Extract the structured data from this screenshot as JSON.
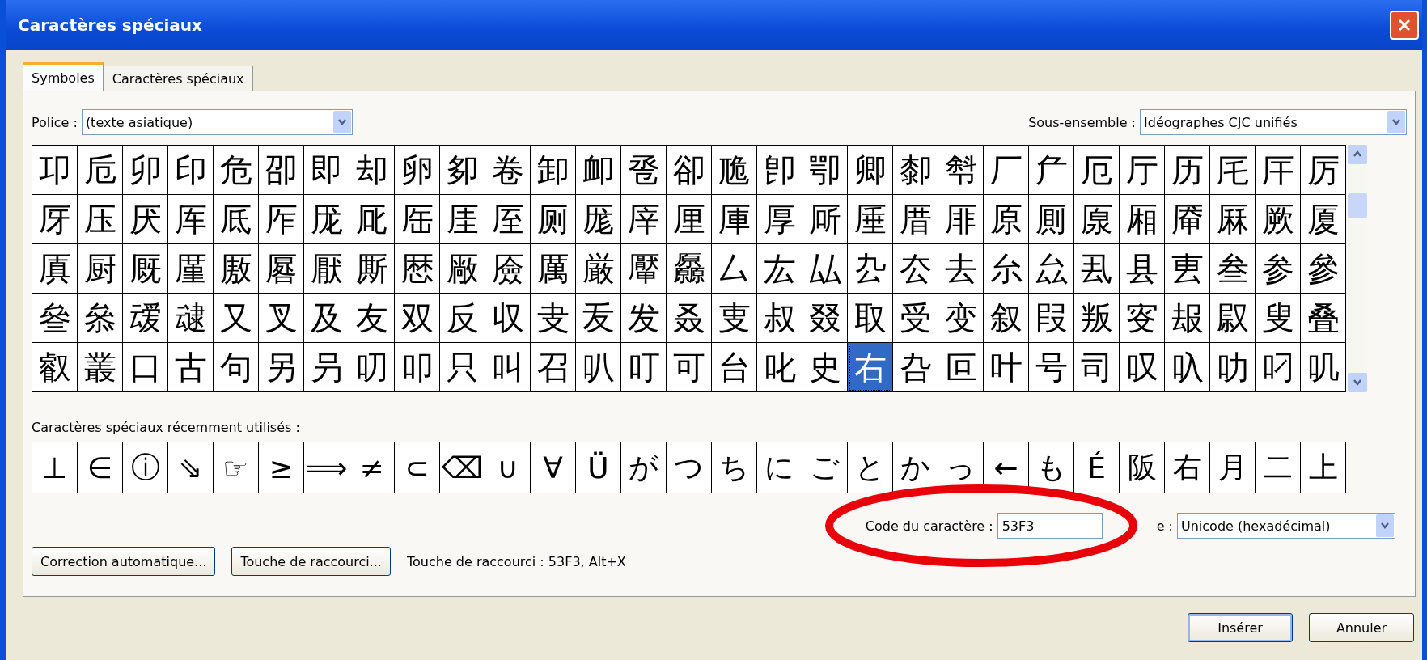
{
  "window": {
    "title": "Caractères spéciaux"
  },
  "tabs": [
    {
      "label": "Symboles",
      "selected": true
    },
    {
      "label": "Caractères spéciaux",
      "selected": false
    }
  ],
  "font_field": {
    "label": "Police :",
    "value": "(texte asiatique)"
  },
  "subset_field": {
    "label": "Sous-ensemble :",
    "value": "Idéographes CJC unifiés"
  },
  "grid": [
    [
      {
        "char": "卭",
        "selected": false
      },
      {
        "char": "卮",
        "selected": false
      },
      {
        "char": "卯",
        "selected": false
      },
      {
        "char": "印",
        "selected": false
      },
      {
        "char": "危",
        "selected": false
      },
      {
        "char": "卲",
        "selected": false
      },
      {
        "char": "即",
        "selected": false
      },
      {
        "char": "却",
        "selected": false
      },
      {
        "char": "卵",
        "selected": false
      },
      {
        "char": "卶",
        "selected": false
      },
      {
        "char": "卷",
        "selected": false
      },
      {
        "char": "卸",
        "selected": false
      },
      {
        "char": "卹",
        "selected": false
      },
      {
        "char": "卺",
        "selected": false
      },
      {
        "char": "卻",
        "selected": false
      },
      {
        "char": "卼",
        "selected": false
      },
      {
        "char": "卽",
        "selected": false
      },
      {
        "char": "卾",
        "selected": false
      },
      {
        "char": "卿",
        "selected": false
      },
      {
        "char": "厀",
        "selected": false
      },
      {
        "char": "厁",
        "selected": false
      },
      {
        "char": "厂",
        "selected": false
      },
      {
        "char": "厃",
        "selected": false
      },
      {
        "char": "厄",
        "selected": false
      },
      {
        "char": "厅",
        "selected": false
      },
      {
        "char": "历",
        "selected": false
      },
      {
        "char": "厇",
        "selected": false
      },
      {
        "char": "厈",
        "selected": false
      },
      {
        "char": "厉",
        "selected": false
      }
    ],
    [
      {
        "char": "厊",
        "selected": false
      },
      {
        "char": "压",
        "selected": false
      },
      {
        "char": "厌",
        "selected": false
      },
      {
        "char": "厍",
        "selected": false
      },
      {
        "char": "厎",
        "selected": false
      },
      {
        "char": "厏",
        "selected": false
      },
      {
        "char": "厐",
        "selected": false
      },
      {
        "char": "厑",
        "selected": false
      },
      {
        "char": "厒",
        "selected": false
      },
      {
        "char": "厓",
        "selected": false
      },
      {
        "char": "厔",
        "selected": false
      },
      {
        "char": "厕",
        "selected": false
      },
      {
        "char": "厖",
        "selected": false
      },
      {
        "char": "厗",
        "selected": false
      },
      {
        "char": "厘",
        "selected": false
      },
      {
        "char": "厙",
        "selected": false
      },
      {
        "char": "厚",
        "selected": false
      },
      {
        "char": "厛",
        "selected": false
      },
      {
        "char": "厜",
        "selected": false
      },
      {
        "char": "厝",
        "selected": false
      },
      {
        "char": "厞",
        "selected": false
      },
      {
        "char": "原",
        "selected": false
      },
      {
        "char": "厠",
        "selected": false
      },
      {
        "char": "厡",
        "selected": false
      },
      {
        "char": "厢",
        "selected": false
      },
      {
        "char": "厣",
        "selected": false
      },
      {
        "char": "厤",
        "selected": false
      },
      {
        "char": "厥",
        "selected": false
      },
      {
        "char": "厦",
        "selected": false
      }
    ],
    [
      {
        "char": "厧",
        "selected": false
      },
      {
        "char": "厨",
        "selected": false
      },
      {
        "char": "厩",
        "selected": false
      },
      {
        "char": "厪",
        "selected": false
      },
      {
        "char": "厫",
        "selected": false
      },
      {
        "char": "厬",
        "selected": false
      },
      {
        "char": "厭",
        "selected": false
      },
      {
        "char": "厮",
        "selected": false
      },
      {
        "char": "厯",
        "selected": false
      },
      {
        "char": "厰",
        "selected": false
      },
      {
        "char": "厱",
        "selected": false
      },
      {
        "char": "厲",
        "selected": false
      },
      {
        "char": "厳",
        "selected": false
      },
      {
        "char": "厴",
        "selected": false
      },
      {
        "char": "厵",
        "selected": false
      },
      {
        "char": "厶",
        "selected": false
      },
      {
        "char": "厷",
        "selected": false
      },
      {
        "char": "厸",
        "selected": false
      },
      {
        "char": "厹",
        "selected": false
      },
      {
        "char": "厺",
        "selected": false
      },
      {
        "char": "去",
        "selected": false
      },
      {
        "char": "厼",
        "selected": false
      },
      {
        "char": "厽",
        "selected": false
      },
      {
        "char": "厾",
        "selected": false
      },
      {
        "char": "县",
        "selected": false
      },
      {
        "char": "叀",
        "selected": false
      },
      {
        "char": "叁",
        "selected": false
      },
      {
        "char": "参",
        "selected": false
      },
      {
        "char": "參",
        "selected": false
      }
    ],
    [
      {
        "char": "叄",
        "selected": false
      },
      {
        "char": "叅",
        "selected": false
      },
      {
        "char": "叆",
        "selected": false
      },
      {
        "char": "叇",
        "selected": false
      },
      {
        "char": "又",
        "selected": false
      },
      {
        "char": "叉",
        "selected": false
      },
      {
        "char": "及",
        "selected": false
      },
      {
        "char": "友",
        "selected": false
      },
      {
        "char": "双",
        "selected": false
      },
      {
        "char": "反",
        "selected": false
      },
      {
        "char": "収",
        "selected": false
      },
      {
        "char": "叏",
        "selected": false
      },
      {
        "char": "叐",
        "selected": false
      },
      {
        "char": "发",
        "selected": false
      },
      {
        "char": "叒",
        "selected": false
      },
      {
        "char": "叓",
        "selected": false
      },
      {
        "char": "叔",
        "selected": false
      },
      {
        "char": "叕",
        "selected": false
      },
      {
        "char": "取",
        "selected": false
      },
      {
        "char": "受",
        "selected": false
      },
      {
        "char": "变",
        "selected": false
      },
      {
        "char": "叙",
        "selected": false
      },
      {
        "char": "叚",
        "selected": false
      },
      {
        "char": "叛",
        "selected": false
      },
      {
        "char": "叜",
        "selected": false
      },
      {
        "char": "叝",
        "selected": false
      },
      {
        "char": "叞",
        "selected": false
      },
      {
        "char": "叟",
        "selected": false
      },
      {
        "char": "叠",
        "selected": false
      }
    ],
    [
      {
        "char": "叡",
        "selected": false
      },
      {
        "char": "叢",
        "selected": false
      },
      {
        "char": "口",
        "selected": false
      },
      {
        "char": "古",
        "selected": false
      },
      {
        "char": "句",
        "selected": false
      },
      {
        "char": "另",
        "selected": false
      },
      {
        "char": "叧",
        "selected": false
      },
      {
        "char": "叨",
        "selected": false
      },
      {
        "char": "叩",
        "selected": false
      },
      {
        "char": "只",
        "selected": false
      },
      {
        "char": "叫",
        "selected": false
      },
      {
        "char": "召",
        "selected": false
      },
      {
        "char": "叭",
        "selected": false
      },
      {
        "char": "叮",
        "selected": false
      },
      {
        "char": "可",
        "selected": false
      },
      {
        "char": "台",
        "selected": false
      },
      {
        "char": "叱",
        "selected": false
      },
      {
        "char": "史",
        "selected": false
      },
      {
        "char": "右",
        "selected": true
      },
      {
        "char": "叴",
        "selected": false
      },
      {
        "char": "叵",
        "selected": false
      },
      {
        "char": "叶",
        "selected": false
      },
      {
        "char": "号",
        "selected": false
      },
      {
        "char": "司",
        "selected": false
      },
      {
        "char": "叹",
        "selected": false
      },
      {
        "char": "叺",
        "selected": false
      },
      {
        "char": "叻",
        "selected": false
      },
      {
        "char": "叼",
        "selected": false
      },
      {
        "char": "叽",
        "selected": false
      }
    ]
  ],
  "recent": {
    "label": "Caractères spéciaux récemment utilisés :",
    "chars": [
      "⊥",
      "∈",
      "ⓘ",
      "⇘",
      "☞",
      "≥",
      "⟹",
      "≠",
      "⊂",
      "⌫",
      "∪",
      "∀",
      "Ü",
      "が",
      "つ",
      "ち",
      "に",
      "ご",
      "と",
      "か",
      "っ",
      "←",
      "も",
      "É",
      "阪",
      "右",
      "月",
      "二",
      "上"
    ]
  },
  "char_code": {
    "label": "Code du caractère :",
    "value": "53F3"
  },
  "encoding": {
    "label": "e :",
    "value": "Unicode (hexadécimal)"
  },
  "autocorrect_button": "Correction automatique...",
  "shortcut_button": "Touche de raccourci...",
  "shortcut_text": "Touche de raccourci : 53F3, Alt+X",
  "insert_button": "Insérer",
  "cancel_button": "Annuler"
}
